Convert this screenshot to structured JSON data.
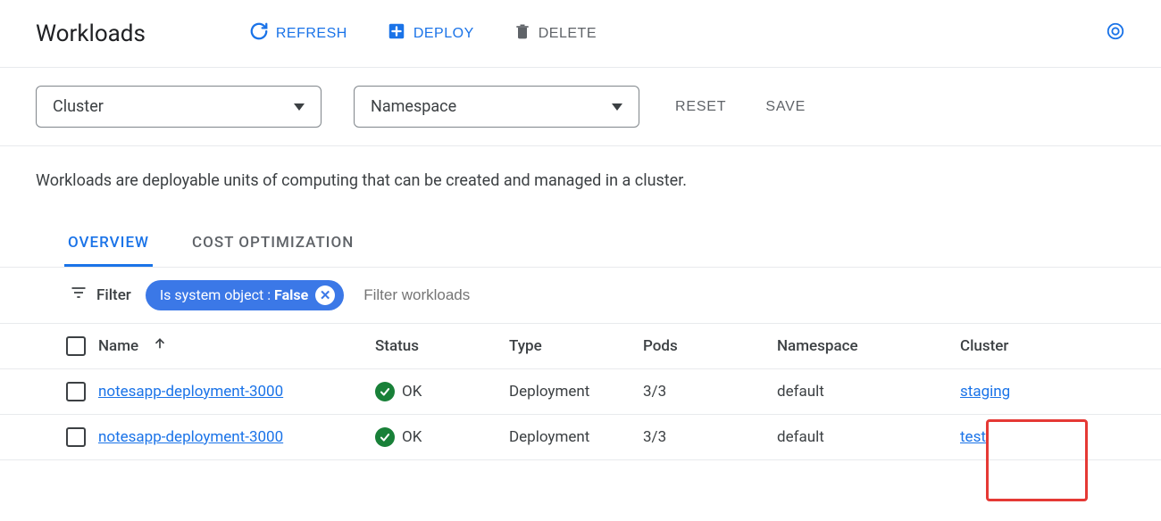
{
  "header": {
    "title": "Workloads",
    "refresh": "REFRESH",
    "deploy": "DEPLOY",
    "delete": "DELETE"
  },
  "filters": {
    "cluster_label": "Cluster",
    "namespace_label": "Namespace",
    "reset": "RESET",
    "save": "SAVE"
  },
  "description": "Workloads are deployable units of computing that can be created and managed in a cluster.",
  "tabs": {
    "overview": "OVERVIEW",
    "cost": "COST OPTIMIZATION"
  },
  "filterbar": {
    "label": "Filter",
    "chip_prefix": "Is system object : ",
    "chip_value": "False",
    "placeholder": "Filter workloads"
  },
  "columns": {
    "name": "Name",
    "status": "Status",
    "type": "Type",
    "pods": "Pods",
    "namespace": "Namespace",
    "cluster": "Cluster"
  },
  "status_ok_text": "OK",
  "rows": [
    {
      "name": "notesapp-deployment-3000",
      "status": "OK",
      "type": "Deployment",
      "pods": "3/3",
      "namespace": "default",
      "cluster": "staging"
    },
    {
      "name": "notesapp-deployment-3000",
      "status": "OK",
      "type": "Deployment",
      "pods": "3/3",
      "namespace": "default",
      "cluster": "test"
    }
  ]
}
